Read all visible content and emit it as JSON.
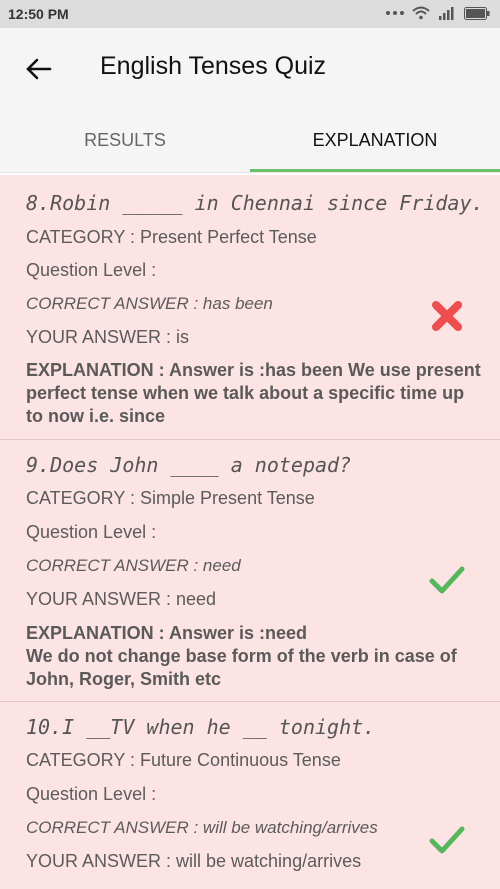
{
  "status_bar": {
    "time": "12:50 PM"
  },
  "app_bar": {
    "title": "English Tenses Quiz"
  },
  "tabs": [
    {
      "label": "RESULTS",
      "selected": false
    },
    {
      "label": "EXPLANATION",
      "selected": true
    }
  ],
  "colors": {
    "accent": "#6cc06a",
    "wrong": "#f04d4d",
    "right": "#54b85a",
    "card_bg": "#fde4e4"
  },
  "questions": [
    {
      "question": "8.Robin _____ in Chennai since Friday.",
      "category": "CATEGORY : Present Perfect Tense",
      "level": "Question Level :",
      "correct": "CORRECT ANSWER : has been",
      "your": "YOUR ANSWER : is",
      "explanation": "EXPLANATION : Answer is :has been We use present perfect tense when we talk about a specific time up to now i.e. since",
      "mark_icon": "cross-icon"
    },
    {
      "question": "9.Does John ____ a notepad?",
      "category": "CATEGORY : Simple Present Tense",
      "level": "Question Level :",
      "correct": "CORRECT ANSWER : need",
      "your": "YOUR ANSWER : need",
      "explanation_1": "EXPLANATION : Answer is :need",
      "explanation_2": "We do not change base form of the verb in case of John, Roger, Smith etc",
      "mark_icon": "check-icon"
    },
    {
      "question": "10.I __TV when he __ tonight.",
      "category": "CATEGORY : Future Continuous Tense",
      "level": "Question Level :",
      "correct": "CORRECT ANSWER : will be watching/arrives",
      "your": "YOUR ANSWER : will be watching/arrives",
      "mark_icon": "check-icon"
    }
  ]
}
